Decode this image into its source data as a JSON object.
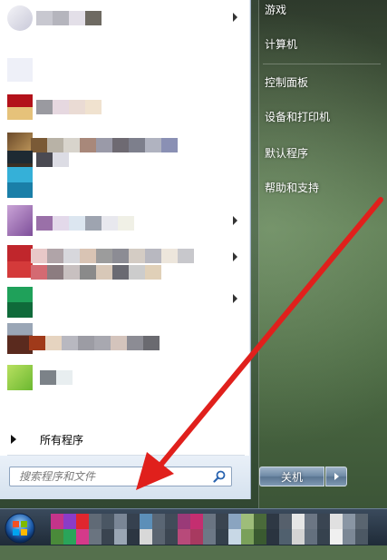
{
  "start_menu": {
    "right_items": [
      {
        "label": "游戏"
      },
      {
        "label": "计算机"
      },
      {
        "label": "控制面板"
      },
      {
        "label": "设备和打印机"
      },
      {
        "label": "默认程序"
      },
      {
        "label": "帮助和支持"
      }
    ],
    "all_programs_label": "所有程序",
    "search": {
      "placeholder": "搜索程序和文件"
    },
    "shutdown_label": "关机"
  },
  "colors": {
    "annotation_arrow": "#e0201c",
    "menu_pane": "#ffffff",
    "taskbar": "#1f2b38"
  }
}
